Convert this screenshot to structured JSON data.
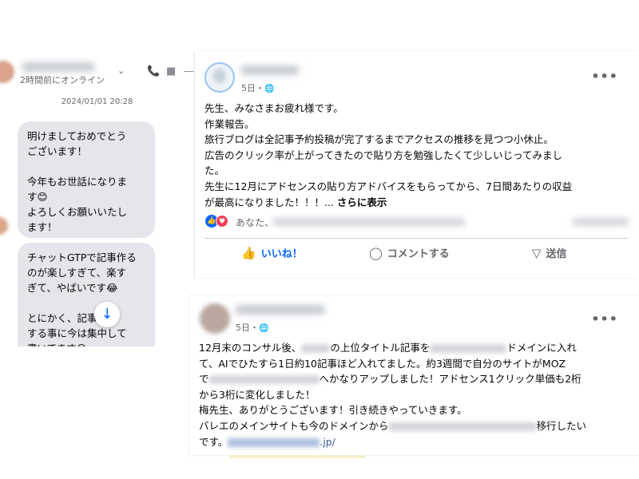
{
  "chat": {
    "status": "2時間前にオンライン",
    "date": "2024/01/01 20:28",
    "icons": {
      "chevron": "chevron-down-icon",
      "phone": "phone-icon",
      "video": "video-icon"
    },
    "messages": [
      "明けましておめでとう\nございます！\n\n今年もお世話になりま\nす😊\nよろしくお願いいたし\nます！",
      "チャットGTPで記事作る\nのが楽しすぎて、楽す\nぎて、やばいです😂\n\nとにかく、記事量産\nする事に今は集中して\n書いてます😅"
    ],
    "scroll_icon": "arrow-down-icon"
  },
  "post1": {
    "time": "5日・",
    "text": "先生、みなさまお疲れ様です。\n作業報告。\n旅行ブログは全記事予約投稿が完了するまでアクセスの推移を見つつ小休止。\n広告のクリック率が上がってきたので貼り方を勉強したくて少しいじってみまし\nた。\n先生に12月にアドセンスの貼り方アドバイスをもらってから、7日間あたりの収益\nが最高になりました！！！... ",
    "see_more": "さらに表示",
    "reaction_prefix": "あなた、",
    "actions": {
      "like": "いいね！",
      "comment": "コメントする",
      "send": "送信"
    },
    "more_icon": "more-dots-icon"
  },
  "post2": {
    "time": "5日・",
    "lines": {
      "l1a": "12月末のコンサル後、",
      "l1b": "の上位タイトル記事を",
      "l1c": "ドメインに入れ",
      "l2": "て、AIでひたすら1日約10記事ほど入れてました。約3週間で自分のサイトがMOZ",
      "l3a": "で",
      "l3b": "へかなりアップしました！アドセンス1クリック単価も2桁",
      "l4": "から3桁に変化しました！",
      "l5": "梅先生、ありがとうございます！引き続きやっていきます。",
      "l6a": "バレエのメインサイトも今のドメインから",
      "l6b": "移行したい",
      "l7a": "です。",
      "l7b": ".jp/"
    },
    "more_icon": "more-dots-icon"
  },
  "colors": {
    "accent": "#0866ff",
    "bubble": "#e4e6eb",
    "link": "#385898"
  }
}
